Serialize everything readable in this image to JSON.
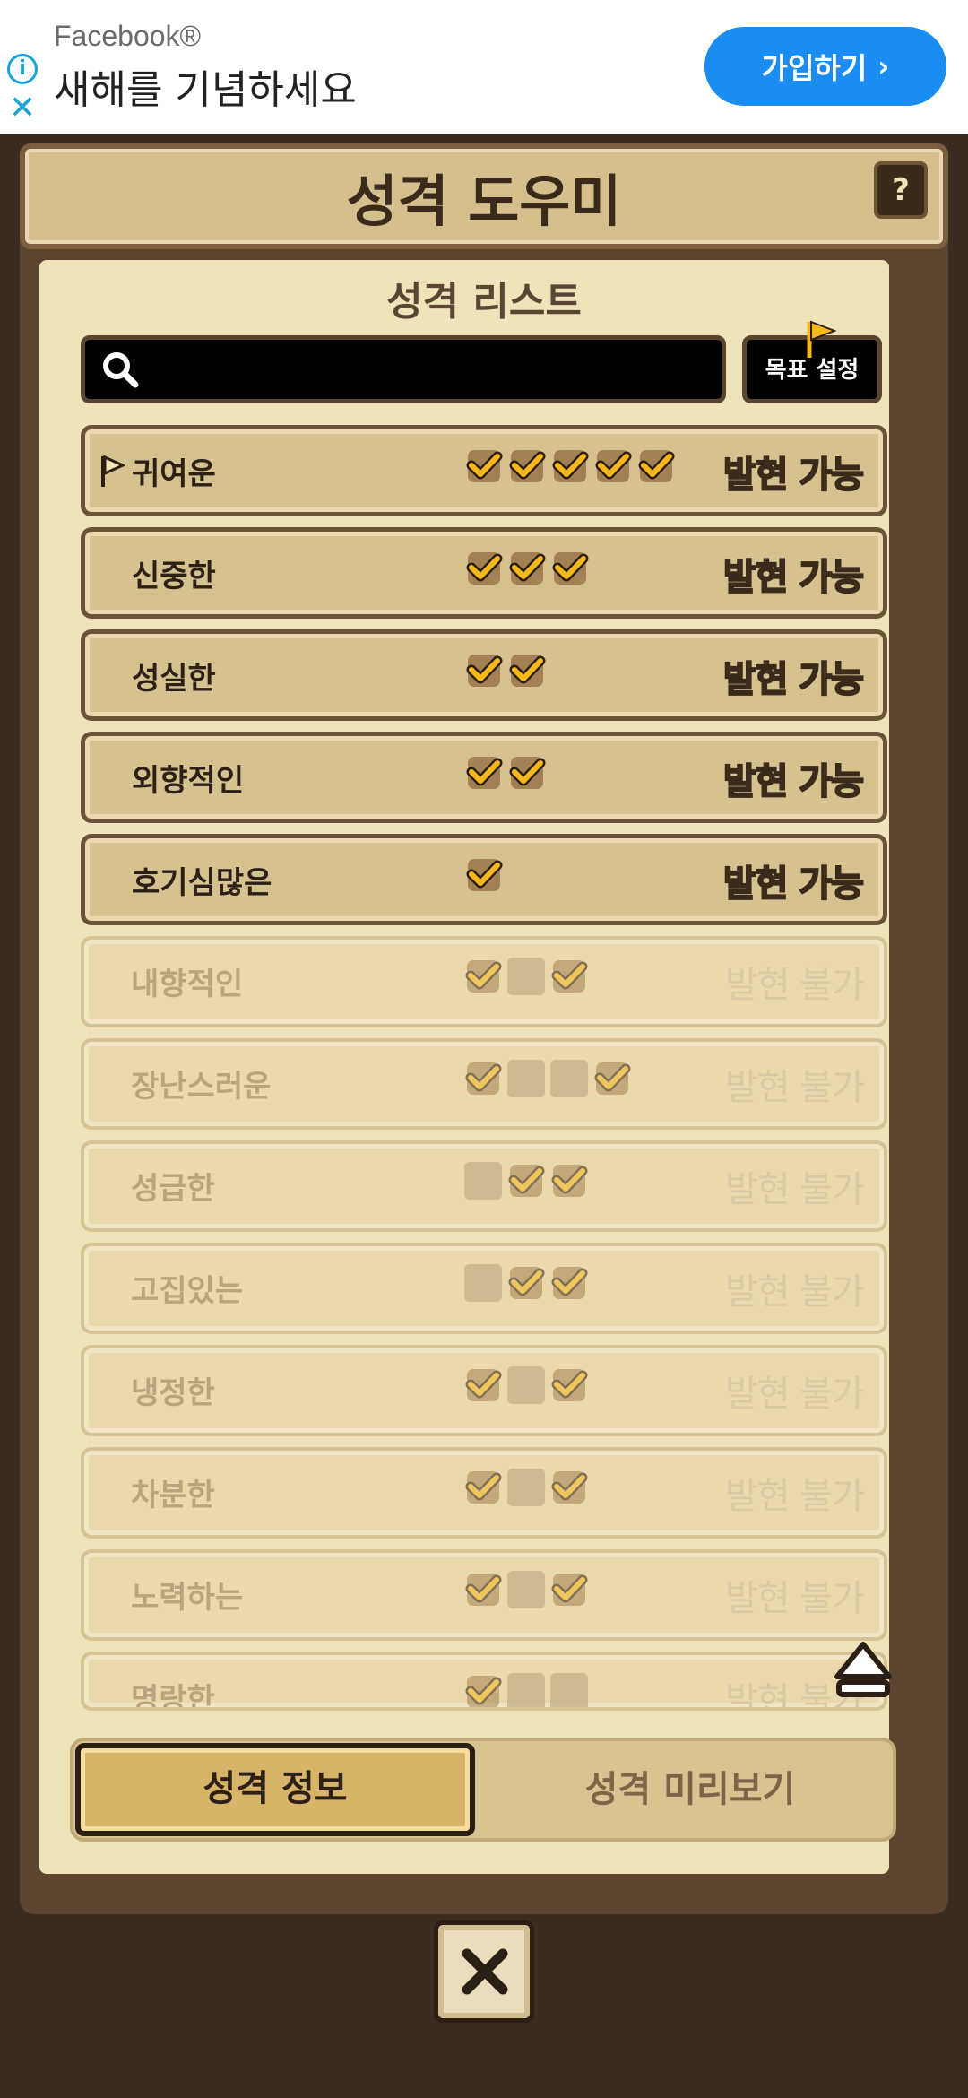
{
  "ad": {
    "brand": "Facebook®",
    "headline": "새해를 기념하세요",
    "cta": "가입하기",
    "icons": [
      "info-icon",
      "close-icon",
      "chevron-right-icon"
    ]
  },
  "panel": {
    "title": "성격 도우미",
    "help_label": "?",
    "list_title": "성격 리스트",
    "search_placeholder": "",
    "goal_button": "목표 설정"
  },
  "rows": [
    {
      "name": "귀여운",
      "marks": [
        "check",
        "check",
        "check",
        "check",
        "check"
      ],
      "status": "발현 가능",
      "enabled": true,
      "flag": true
    },
    {
      "name": "신중한",
      "marks": [
        "check",
        "check",
        "check"
      ],
      "status": "발현 가능",
      "enabled": true,
      "flag": false
    },
    {
      "name": "성실한",
      "marks": [
        "check",
        "check"
      ],
      "status": "발현 가능",
      "enabled": true,
      "flag": false
    },
    {
      "name": "외향적인",
      "marks": [
        "check",
        "check"
      ],
      "status": "발현 가능",
      "enabled": true,
      "flag": false
    },
    {
      "name": "호기심많은",
      "marks": [
        "check"
      ],
      "status": "발현 가능",
      "enabled": true,
      "flag": false
    },
    {
      "name": "내향적인",
      "marks": [
        "check",
        "empty",
        "check"
      ],
      "status": "발현 불가",
      "enabled": false,
      "flag": false
    },
    {
      "name": "장난스러운",
      "marks": [
        "check",
        "empty",
        "empty",
        "check"
      ],
      "status": "발현 불가",
      "enabled": false,
      "flag": false
    },
    {
      "name": "성급한",
      "marks": [
        "empty",
        "check",
        "check"
      ],
      "status": "발현 불가",
      "enabled": false,
      "flag": false
    },
    {
      "name": "고집있는",
      "marks": [
        "empty",
        "check",
        "check"
      ],
      "status": "발현 불가",
      "enabled": false,
      "flag": false
    },
    {
      "name": "냉정한",
      "marks": [
        "check",
        "empty",
        "check"
      ],
      "status": "발현 불가",
      "enabled": false,
      "flag": false
    },
    {
      "name": "차분한",
      "marks": [
        "check",
        "empty",
        "check"
      ],
      "status": "발현 불가",
      "enabled": false,
      "flag": false
    },
    {
      "name": "노력하는",
      "marks": [
        "check",
        "empty",
        "check"
      ],
      "status": "발현 불가",
      "enabled": false,
      "flag": false
    },
    {
      "name": "명랑한",
      "marks": [
        "check",
        "empty",
        "empty"
      ],
      "status": "발현 불가",
      "enabled": false,
      "flag": false
    }
  ],
  "tabs": {
    "info": "성격 정보",
    "preview": "성격 미리보기"
  },
  "colors": {
    "accent_gold": "#f7b81c",
    "frame_brown": "#5b4530",
    "ad_button_blue": "#1a8cf2"
  }
}
